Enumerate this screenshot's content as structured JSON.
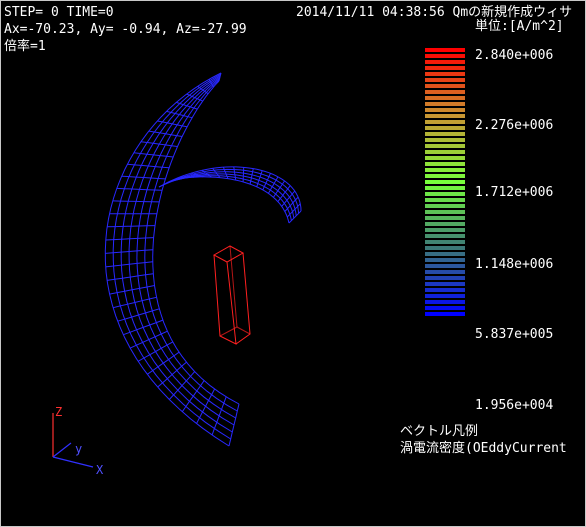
{
  "header": {
    "step_time": "STEP=   0  TIME=0",
    "datetime": "2014/11/11 04:38:56 Qmの新規作成ウィサ",
    "angles": "Ax=-70.23, Ay= -0.94, Az=-27.99",
    "scale": "倍率=1"
  },
  "legend": {
    "unit": "単位:[A/m^2]",
    "ticks": [
      "2.840e+006",
      "2.276e+006",
      "1.712e+006",
      "1.148e+006",
      "5.837e+005",
      "1.956e+004"
    ],
    "title": "ベクトル凡例",
    "quantity": "渦電流密度(OEddyCurrent",
    "colors": {
      "top": "#ff0000",
      "mid_upper": "#c89632",
      "middle": "#78ff3c",
      "mid_lower": "#3c7878",
      "bottom": "#0000ff"
    }
  },
  "axes": {
    "z": "Z",
    "y": "y",
    "x": "X"
  }
}
